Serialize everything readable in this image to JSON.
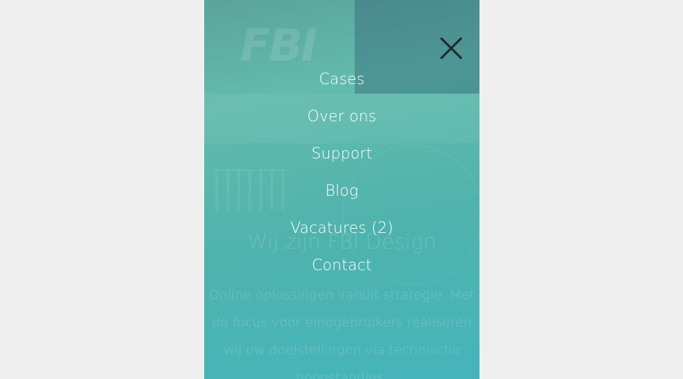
{
  "page": {
    "background_color": "#efefef",
    "overlay_gradient_colors": [
      "#5aa39b",
      "#63bbac",
      "#4fb3ad",
      "#45b4bb"
    ]
  },
  "background_page": {
    "logo_text": "FBI",
    "heading": "Wij zijn FBI Design",
    "paragraph": "Online oplossingen vanuit strategie. Met de focus voor eindgebruikers realiseren wij uw doelstellingen via technische hoogstandjes."
  },
  "overlay": {
    "close_icon": "close-icon",
    "menu_items": [
      {
        "label": "Cases"
      },
      {
        "label": "Over ons"
      },
      {
        "label": "Support"
      },
      {
        "label": "Blog"
      },
      {
        "label": "Vacatures (2)"
      },
      {
        "label": "Contact"
      }
    ]
  }
}
